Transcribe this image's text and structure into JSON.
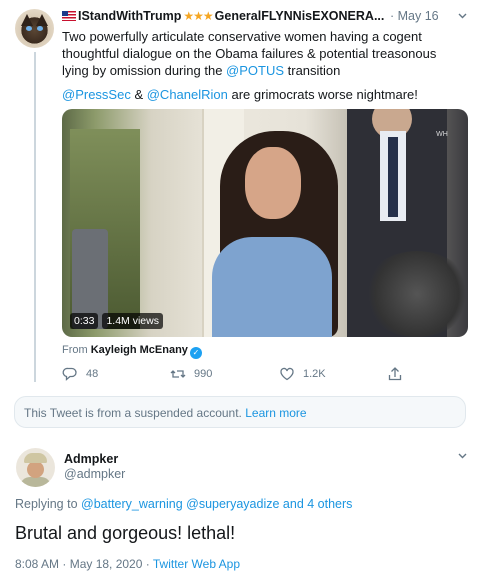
{
  "tweet1": {
    "display_name": "IStandWithTrump",
    "stars": "★★★",
    "display_name_suffix": "GeneralFLYNNisEXONERA...",
    "date": "· May 16",
    "text_line": "Two powerfully articulate conservative women having a cogent thoughtful dialogue on the Obama failures & potential treasonous lying by omission during the ",
    "potus_link": "@POTUS",
    "text_tail": " transition",
    "mention1": "@PressSec",
    "amp": " & ",
    "mention2": "@ChanelRion",
    "mention_tail": " are grimocrats worse nightmare!",
    "video": {
      "duration": "0:33",
      "views": "1.4M views",
      "logo_text": "WH"
    },
    "from_prefix": "From ",
    "from_source": "Kayleigh McEnany",
    "verified_mark": "✓",
    "actions": {
      "replies": "48",
      "retweets": "990",
      "likes": "1.2K"
    }
  },
  "suspended": {
    "text": "This Tweet is from a suspended account. ",
    "learn_more": "Learn more"
  },
  "tweet2": {
    "display_name": "Admpker",
    "handle": "@admpker",
    "replying_prefix": "Replying to ",
    "reply_mention1": "@battery_warning",
    "reply_mention2": "@superyayadize",
    "reply_others": "and 4 others",
    "body": "Brutal and gorgeous! lethal!",
    "timestamp": "8:08 AM · May 18, 2020 · ",
    "client": "Twitter Web App"
  },
  "icons": {
    "chevron": "chevron-down-icon",
    "reply": "reply-icon",
    "retweet": "retweet-icon",
    "like": "heart-icon",
    "share": "share-icon"
  },
  "colors": {
    "link": "#1b95e0",
    "muted": "#657786",
    "verified": "#1da1f2",
    "stars": "#f5a623"
  }
}
